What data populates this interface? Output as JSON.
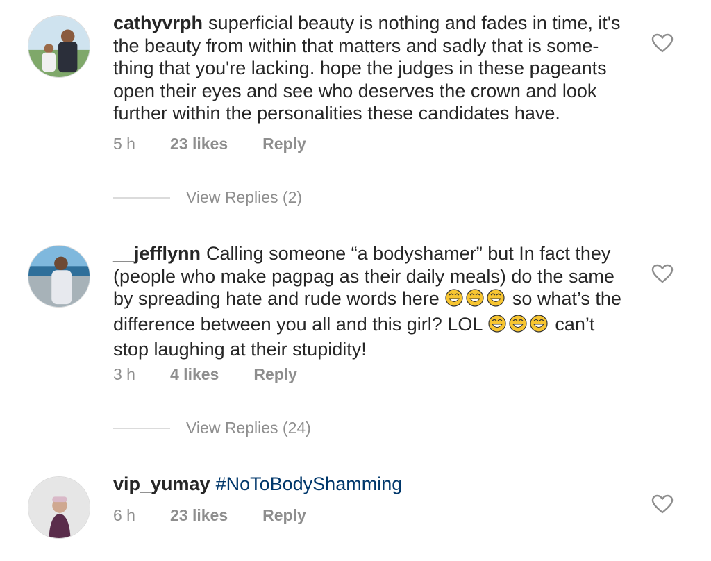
{
  "comments": [
    {
      "username": "cathyvrph",
      "text": "superficial beauty is nothing and fades in time, it's the beauty from within that matters and sadly that is some-thing that you're lacking. hope the judges in these pageants open their eyes and see who deserves the crown and look further within the personalities these candidates have.",
      "time": "5 h",
      "likes": "23 likes",
      "reply": "Reply",
      "view_replies": "View Replies (2)"
    },
    {
      "username": "__jefflynn",
      "text_parts": [
        "Calling someone “a bodyshamer” but In fact they (people who make pagpag as their daily meals) do the same by spreading hate and rude words here ",
        " so what’s the difference between you all and this girl? LOL ",
        " can’t stop laughing at their stupidity!"
      ],
      "time": "3 h",
      "likes": "4 likes",
      "reply": "Reply",
      "view_replies": "View Replies (24)"
    },
    {
      "username": "vip_yumay",
      "text": "#NoToBodyShamming",
      "time": "6 h",
      "likes": "23 likes",
      "reply": "Reply"
    }
  ],
  "icons": {
    "like": "heart-outline-icon",
    "emoji": "face-with-tears-of-joy-emoji"
  },
  "colors": {
    "text": "#262626",
    "secondary": "#8e8e8e",
    "hashtag": "#00376b",
    "divider": "#dbdbdb"
  }
}
